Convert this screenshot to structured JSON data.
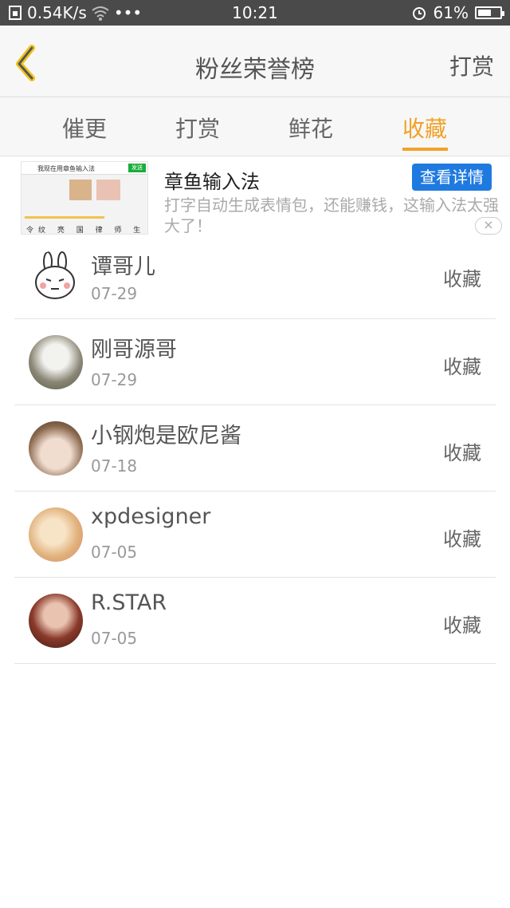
{
  "status_bar": {
    "network_speed": "0.54K/s",
    "dots": "•••",
    "time": "10:21",
    "battery_percent": "61%",
    "battery_level": 0.61
  },
  "header": {
    "title": "粉丝荣誉榜",
    "action_label": "打赏"
  },
  "tabs": [
    {
      "label": "催更",
      "active": false
    },
    {
      "label": "打赏",
      "active": false
    },
    {
      "label": "鲜花",
      "active": false
    },
    {
      "label": "收藏",
      "active": true
    }
  ],
  "ad": {
    "title": "章鱼输入法",
    "description": "打字自动生成表情包，还能赚钱，这输入法太强大了！",
    "button_label": "查看详情",
    "close_symbol": "×",
    "thumb_bar_text": "我现在用章鱼输入法",
    "thumb_send": "发送",
    "thumb_keys": "令纹 亮 国 律 师 生"
  },
  "list": [
    {
      "name": "谭哥儿",
      "date": "07-29",
      "type": "收藏"
    },
    {
      "name": "刚哥源哥",
      "date": "07-29",
      "type": "收藏"
    },
    {
      "name": "小钢炮是欧尼酱",
      "date": "07-18",
      "type": "收藏"
    },
    {
      "name": "xpdesigner",
      "date": "07-05",
      "type": "收藏"
    },
    {
      "name": "R.STAR",
      "date": "07-05",
      "type": "收藏"
    }
  ],
  "colors": {
    "accent": "#f2a127",
    "status_bar": "#4a4a4a",
    "ad_button": "#1f7ae0"
  }
}
